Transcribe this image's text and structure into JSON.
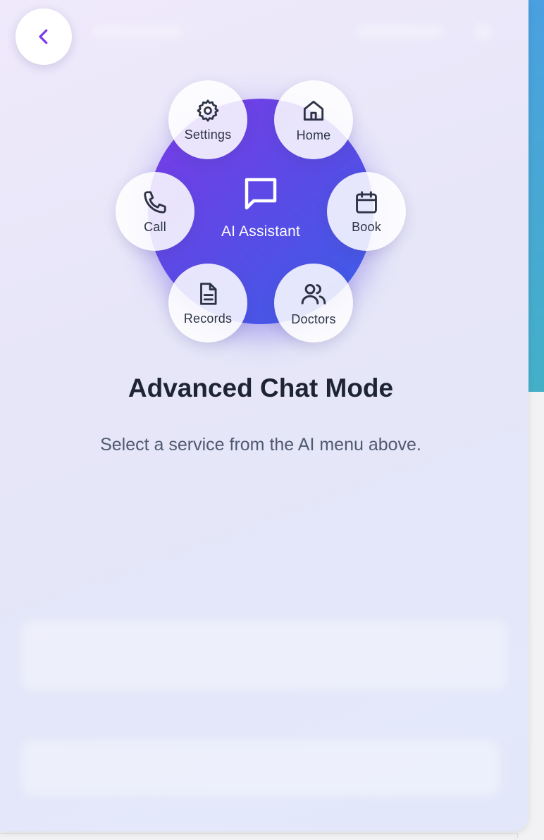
{
  "colors": {
    "accent": "#7b3ae6",
    "hub_gradient_start": "#7b3ae6",
    "hub_gradient_end": "#3a5fe8",
    "title": "#1e2434",
    "subtitle": "#505a70",
    "node_label": "#2d3344"
  },
  "header": {
    "back_icon": "chevron-left-icon"
  },
  "radial_menu": {
    "center": {
      "label": "AI Assistant",
      "icon": "message-square-icon"
    },
    "items": [
      {
        "label": "Settings",
        "icon": "gear-icon"
      },
      {
        "label": "Home",
        "icon": "home-icon"
      },
      {
        "label": "Call",
        "icon": "phone-icon"
      },
      {
        "label": "Book",
        "icon": "calendar-icon"
      },
      {
        "label": "Records",
        "icon": "document-icon"
      },
      {
        "label": "Doctors",
        "icon": "users-icon"
      }
    ]
  },
  "main": {
    "title": "Advanced Chat Mode",
    "subtitle": "Select a service from the AI menu above."
  }
}
